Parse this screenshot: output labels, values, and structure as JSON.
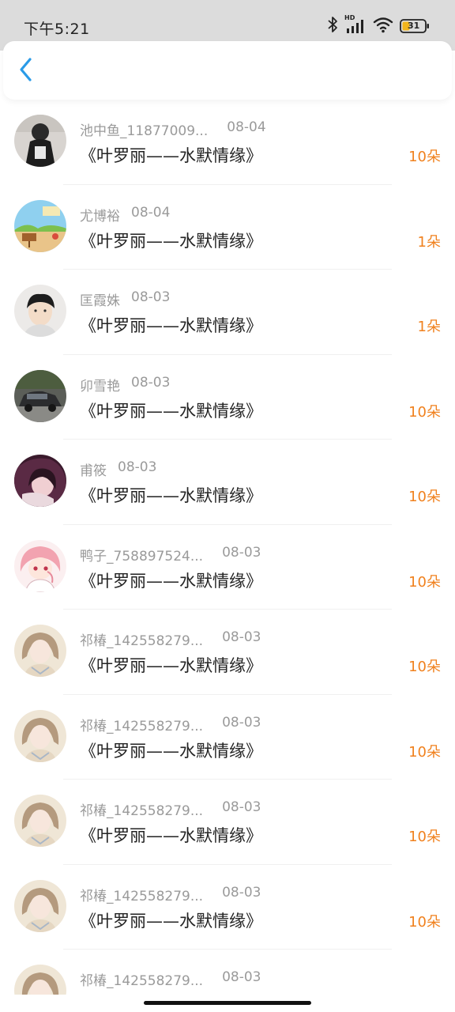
{
  "status_bar": {
    "time": "下午5:21",
    "battery": "31",
    "network_badge": "HD",
    "icons": [
      "bluetooth-icon",
      "cell-signal-icon",
      "wifi-icon",
      "battery-icon"
    ],
    "battery_color": "#f2b51d"
  },
  "header": {
    "back_icon": "chevron-left-icon",
    "accent_color": "#2a9be8"
  },
  "colors": {
    "amount": "#f0811e",
    "meta": "#9a9a9a",
    "title": "#222222"
  },
  "items": [
    {
      "name": "池中鱼_11877009...",
      "date": "08-04",
      "title": "《叶罗丽——水默情缘》",
      "amount": "10朵",
      "avatar": "dark-figure-avatar"
    },
    {
      "name": "尤博裕",
      "date": "08-04",
      "title": "《叶罗丽——水默情缘》",
      "amount": "1朵",
      "avatar": "cartoon-landscape-avatar"
    },
    {
      "name": "匡霞姝",
      "date": "08-03",
      "title": "《叶罗丽——水默情缘》",
      "amount": "1朵",
      "avatar": "portrait-boy-avatar"
    },
    {
      "name": "卯雪艳",
      "date": "08-03",
      "title": "《叶罗丽——水默情缘》",
      "amount": "10朵",
      "avatar": "car-photo-avatar"
    },
    {
      "name": "甫筱",
      "date": "08-03",
      "title": "《叶罗丽——水默情缘》",
      "amount": "10朵",
      "avatar": "girl-purple-hair-avatar"
    },
    {
      "name": "鸭子_758897524...",
      "date": "08-03",
      "title": "《叶罗丽——水默情缘》",
      "amount": "10朵",
      "avatar": "anime-pink-hair-avatar"
    },
    {
      "name": "祁椿_142558279...",
      "date": "08-03",
      "title": "《叶罗丽——水默情缘》",
      "amount": "10朵",
      "avatar": "girl-portrait-avatar"
    },
    {
      "name": "祁椿_142558279...",
      "date": "08-03",
      "title": "《叶罗丽——水默情缘》",
      "amount": "10朵",
      "avatar": "girl-portrait-avatar"
    },
    {
      "name": "祁椿_142558279...",
      "date": "08-03",
      "title": "《叶罗丽——水默情缘》",
      "amount": "10朵",
      "avatar": "girl-portrait-avatar"
    },
    {
      "name": "祁椿_142558279...",
      "date": "08-03",
      "title": "《叶罗丽——水默情缘》",
      "amount": "10朵",
      "avatar": "girl-portrait-avatar"
    },
    {
      "name": "祁椿_142558279...",
      "date": "08-03",
      "title": "",
      "amount": "",
      "avatar": "girl-portrait-avatar"
    }
  ]
}
